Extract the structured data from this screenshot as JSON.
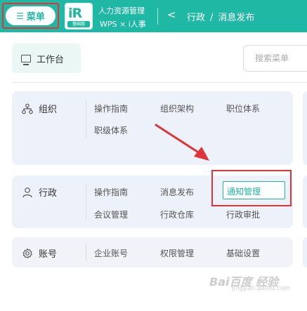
{
  "header": {
    "menu_label": "菜单",
    "logo_mark": "iR",
    "logo_tag": "基础版",
    "brand_line1": "人力资源管理",
    "brand_line2": "WPS × i人事",
    "back_icon": "chevron-left-icon",
    "breadcrumb": [
      "行政",
      "消息发布"
    ],
    "breadcrumb_sep": "/"
  },
  "toolbar": {
    "workbench_label": "工作台",
    "search_placeholder": "搜索菜单"
  },
  "categories": [
    {
      "label": "组织",
      "icon": "org-icon",
      "items": [
        "操作指南",
        "组织架构",
        "职位体系",
        "职级体系"
      ]
    },
    {
      "label": "行政",
      "icon": "user-icon",
      "items": [
        "操作指南",
        "消息发布",
        "通知管理",
        "会议管理",
        "行政仓库",
        "行政审批"
      ]
    },
    {
      "label": "账号",
      "icon": "gear-icon",
      "items": [
        "企业账号",
        "权限管理",
        "基础设置"
      ]
    }
  ],
  "watermark": {
    "text": "Bai百度 经验",
    "sub": "jingyan.baidu.com"
  },
  "colors": {
    "accent": "#1eb8a4",
    "highlight": "#e0333a"
  }
}
